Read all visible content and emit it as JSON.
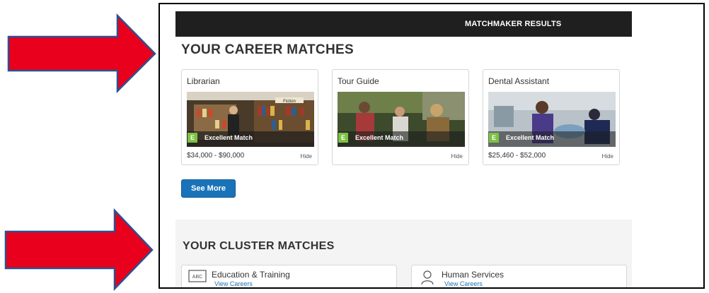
{
  "header": {
    "title": "MATCHMAKER RESULTS"
  },
  "career_section": {
    "title": "YOUR CAREER MATCHES"
  },
  "careers": [
    {
      "title": "Librarian",
      "badge": "E",
      "match": "Excellent Match",
      "salary": "$34,000 - $90,000",
      "hide": "Hide",
      "sign": "Fiction"
    },
    {
      "title": "Tour Guide",
      "badge": "E",
      "match": "Excellent Match",
      "salary": "",
      "hide": "Hide"
    },
    {
      "title": "Dental Assistant",
      "badge": "E",
      "match": "Excellent Match",
      "salary": "$25,460 - $52,000",
      "hide": "Hide"
    }
  ],
  "see_more": "See More",
  "cluster_section": {
    "title": "YOUR CLUSTER MATCHES"
  },
  "clusters": [
    {
      "name": "Education & Training",
      "link": "View Careers",
      "icon": "abc-board-icon",
      "icon_text": "ABC"
    },
    {
      "name": "Human Services",
      "link": "View Careers",
      "icon": "person-icon"
    }
  ],
  "colors": {
    "arrow": "#e8001c",
    "arrow_border": "#2e4f8f",
    "accent": "#1a73b8",
    "match_green": "#7cc242",
    "header_bg": "#1f1f1f"
  }
}
